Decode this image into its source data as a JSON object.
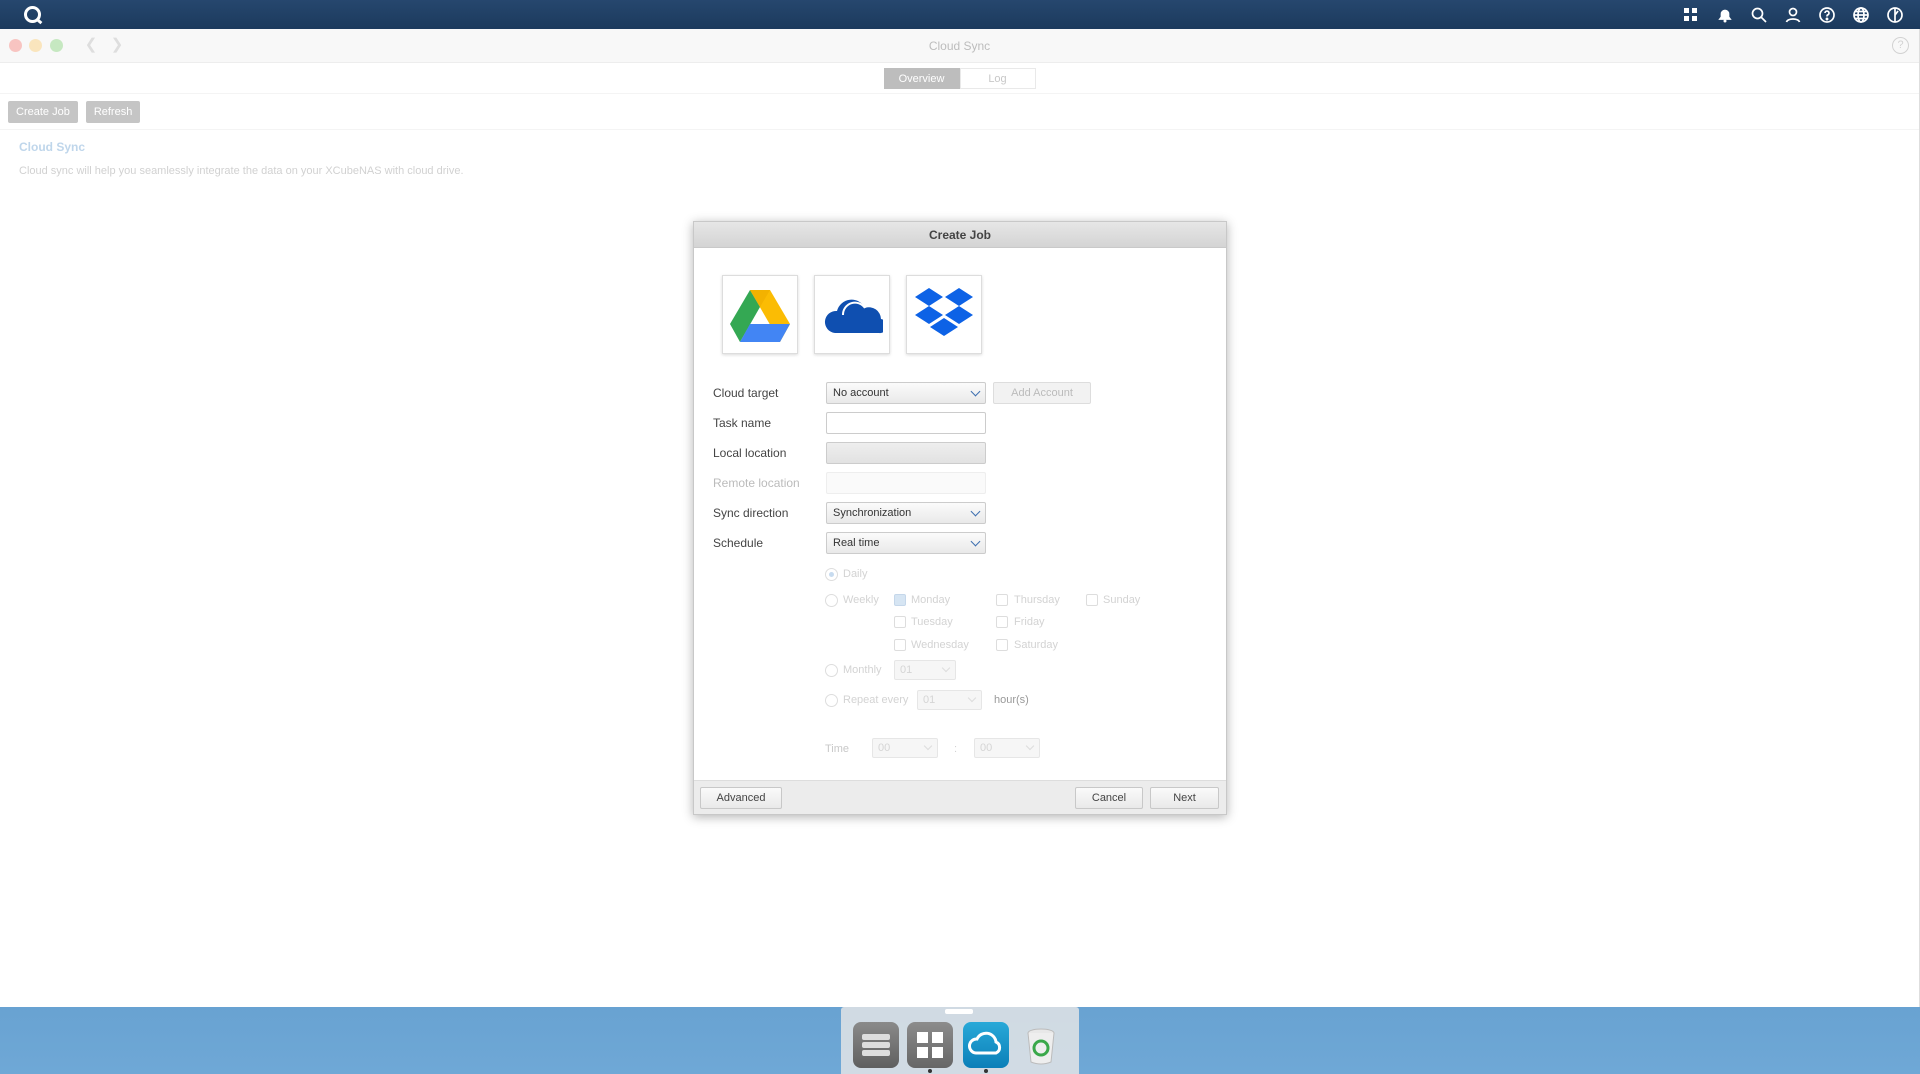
{
  "window": {
    "title": "Cloud Sync"
  },
  "tabs": [
    {
      "label": "Overview",
      "active": true
    },
    {
      "label": "Log",
      "active": false
    }
  ],
  "toolbar": {
    "create_job": "Create Job",
    "refresh": "Refresh"
  },
  "section": {
    "title": "Cloud Sync",
    "description": "Cloud sync will help you seamlessly integrate the data on your XCubeNAS with cloud drive."
  },
  "dialog": {
    "title": "Create Job",
    "providers": [
      {
        "name": "google-drive-icon"
      },
      {
        "name": "onedrive-icon"
      },
      {
        "name": "dropbox-icon"
      }
    ],
    "cloud_target": {
      "label": "Cloud target",
      "value": "No account",
      "add_account": "Add Account"
    },
    "task_name": {
      "label": "Task name",
      "value": ""
    },
    "local_location": {
      "label": "Local location",
      "value": ""
    },
    "remote_location": {
      "label": "Remote location",
      "value": ""
    },
    "sync_direction": {
      "label": "Sync direction",
      "value": "Synchronization"
    },
    "schedule": {
      "label": "Schedule",
      "value": "Real time",
      "daily": "Daily",
      "weekly": "Weekly",
      "days": {
        "monday": "Monday",
        "tuesday": "Tuesday",
        "wednesday": "Wednesday",
        "thursday": "Thursday",
        "friday": "Friday",
        "saturday": "Saturday",
        "sunday": "Sunday"
      },
      "monthly": "Monthly",
      "monthly_value": "01",
      "repeat_every": "Repeat every",
      "repeat_value": "01",
      "repeat_unit": "hour(s)",
      "time_label": "Time",
      "time_hour": "00",
      "time_separator": ":",
      "time_minute": "00"
    },
    "buttons": {
      "advanced": "Advanced",
      "cancel": "Cancel",
      "next": "Next"
    }
  },
  "colors": {
    "accent": "#3d6fb0",
    "topbar": "#1f3e63",
    "section_title": "#9dc0e0"
  }
}
